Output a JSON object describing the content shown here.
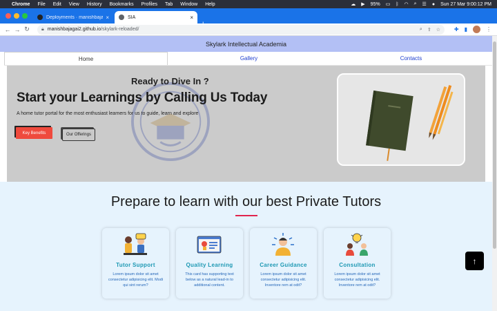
{
  "menubar": {
    "app": "Chrome",
    "items": [
      "File",
      "Edit",
      "View",
      "History",
      "Bookmarks",
      "Profiles",
      "Tab",
      "Window",
      "Help"
    ],
    "battery": "95%",
    "datetime": "Sun 27 Mar  9:00:12 PM"
  },
  "browser": {
    "tabs": [
      {
        "title": "Deployments · manishbajagai2/...",
        "active": false
      },
      {
        "title": "SIA",
        "active": true
      }
    ],
    "url_host": "manishbajagai2.github.io",
    "url_path": "/skylark-reloaded/"
  },
  "site": {
    "name": "Skylark Intellectual Academia",
    "nav": [
      "Home",
      "Gallery",
      "Contacts"
    ],
    "active_nav": "Home"
  },
  "hero": {
    "kicker": "Ready to Dive In ?",
    "headline": "Start your Learnings by Calling Us Today",
    "subtitle": "A home tutor portal for the most enthusiast learners for us to guide, learn and explore",
    "btn_primary": "Key Benefits",
    "btn_secondary": "Our Offerings"
  },
  "tutors": {
    "title": "Prepare to learn with our best Private Tutors",
    "accent": "#e0244d",
    "cards": [
      {
        "title": "Tutor Support",
        "text": "Lorem ipsum dolor sit amet consectetur adipisicing elit. Modi qui sint rerum?",
        "icon": "tutor-support-icon"
      },
      {
        "title": "Quality Learning",
        "text": "This card has supporting text below as a natural lead-in to additional content.",
        "icon": "quality-learning-icon"
      },
      {
        "title": "Career Guidance",
        "text": "Lorem ipsum dolor sit amet consectetur adipisicing elit. Inventore rem at odit?",
        "icon": "career-guidance-icon"
      },
      {
        "title": "Consultation",
        "text": "Lorem ipsum dolor sit amet consectetur adipisicing elit. Inventore rem at odit?",
        "icon": "consultation-icon"
      }
    ]
  },
  "back_to_top": "↑"
}
